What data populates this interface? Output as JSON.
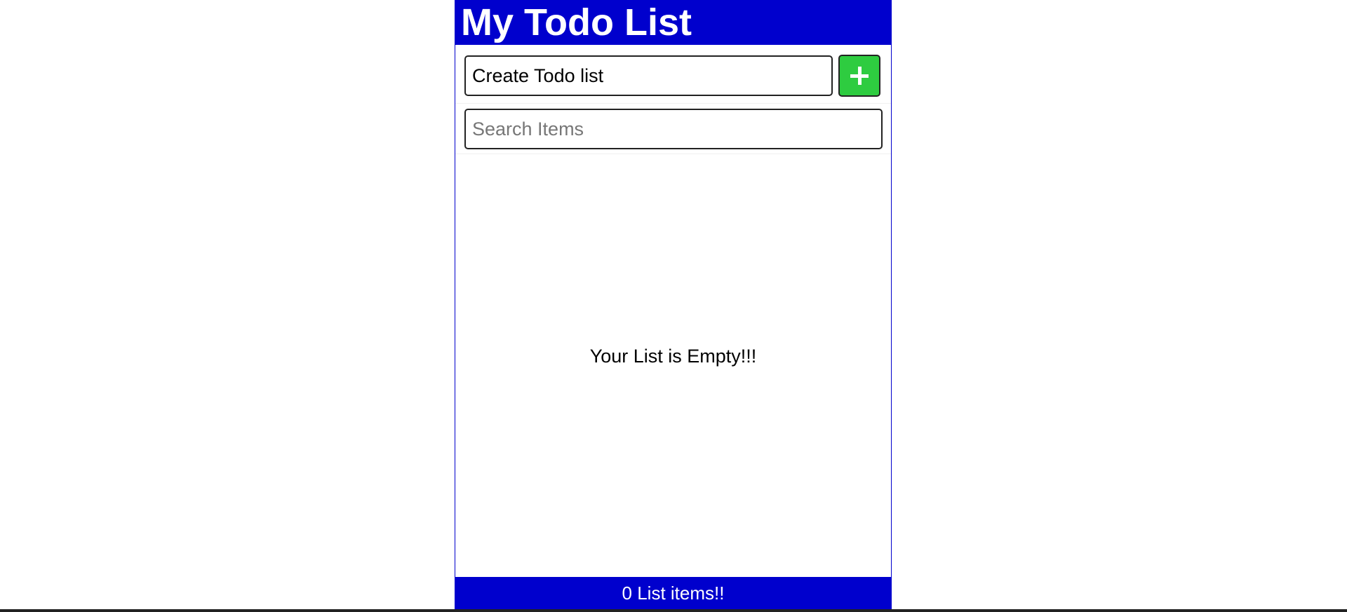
{
  "header": {
    "title": "My Todo List"
  },
  "add_form": {
    "input_value": "Create Todo list",
    "button_icon": "plus-icon"
  },
  "search": {
    "placeholder": "Search Items",
    "value": ""
  },
  "list": {
    "empty_message": "Your List is Empty!!!",
    "items": []
  },
  "footer": {
    "count_text": "0 List items!!"
  },
  "colors": {
    "header_bg": "#0000cd",
    "footer_bg": "#0000cd",
    "add_button_bg": "#2ecc40",
    "text_on_header": "#ffffff"
  }
}
